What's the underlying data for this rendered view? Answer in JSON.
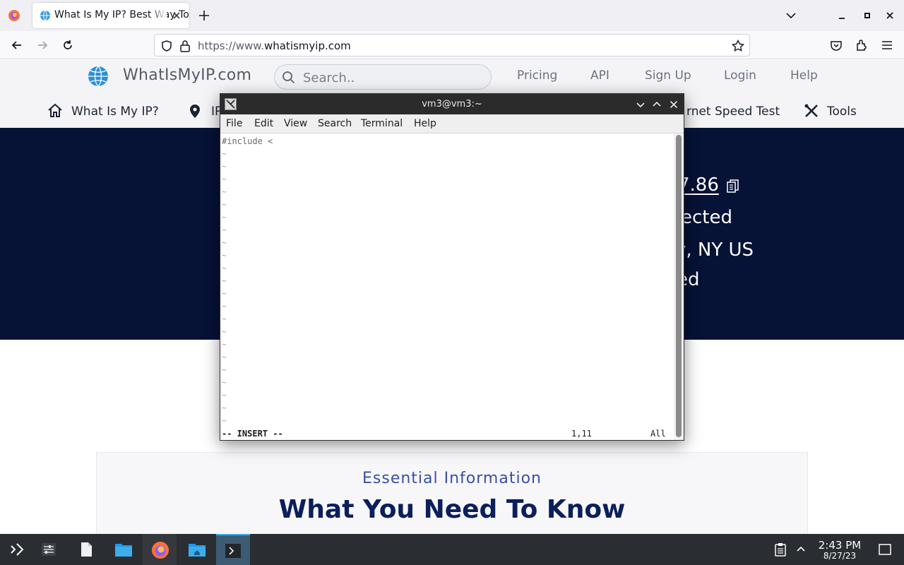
{
  "browser": {
    "tab_title": "What Is My IP? Best Way To Check Your Public IP Address",
    "url_prefix": "https://www.",
    "url_domain": "whatismyip.com"
  },
  "site": {
    "logo_text": "WhatIsMyIP.com",
    "search_placeholder": "Search..",
    "top_links": [
      "Pricing",
      "API",
      "Sign Up",
      "Login",
      "Help"
    ],
    "nav": {
      "what_is_my_ip": "What Is My IP?",
      "ip_partial": "IP",
      "speed_test_partial": "rnet Speed Test",
      "tools": "Tools"
    },
    "hero": {
      "ip_partial": "7.86",
      "line2_partial": "ected",
      "line3_partial": "y, NY US",
      "line4_partial": "ed"
    },
    "info": {
      "kicker": "Essential Information",
      "heading": "What You Need To Know"
    }
  },
  "terminal": {
    "title": "vm3@vm3:~",
    "menu": [
      "File",
      "Edit",
      "View",
      "Search",
      "Terminal",
      "Help"
    ],
    "line1": "#include <",
    "tilde": "~",
    "mode": "-- INSERT --",
    "position": "1,11",
    "scroll_status": "All"
  },
  "taskbar": {
    "time": "2:43 PM",
    "date": "8/27/23"
  }
}
